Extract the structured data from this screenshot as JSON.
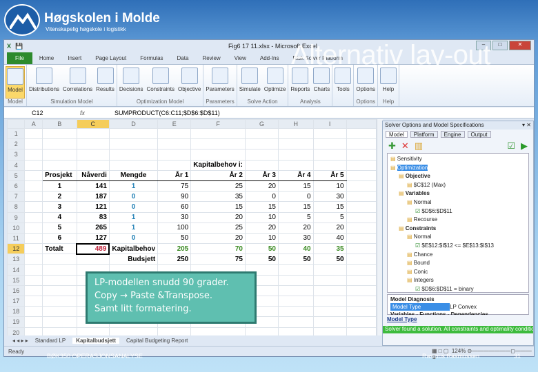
{
  "branding": {
    "org": "Høgskolen i Molde",
    "subtitle": "Vitenskapelig høgskole i logistikk"
  },
  "slide": {
    "title": "Alternativ lay-out",
    "footer_course": "BØK350 OPERASJONSANALYSE",
    "footer_author": "Rasmus Rasmussen",
    "page": "31"
  },
  "window": {
    "title": "Fig6 17 11.xlsx - Microsoft Excel"
  },
  "tabs": [
    "File",
    "Home",
    "Insert",
    "Page Layout",
    "Formulas",
    "Data",
    "Review",
    "View",
    "Add-Ins",
    "Risk Solver Platform"
  ],
  "ribbon": [
    {
      "group": "Model",
      "buttons": [
        "Model"
      ]
    },
    {
      "group": "Simulation Model",
      "buttons": [
        "Distributions",
        "Correlations",
        "Results"
      ]
    },
    {
      "group": "Optimization Model",
      "buttons": [
        "Decisions",
        "Constraints",
        "Objective"
      ]
    },
    {
      "group": "Parameters",
      "buttons": [
        "Parameters"
      ]
    },
    {
      "group": "Solve Action",
      "buttons": [
        "Simulate",
        "Optimize"
      ]
    },
    {
      "group": "Analysis",
      "buttons": [
        "Reports",
        "Charts"
      ]
    },
    {
      "group": "",
      "buttons": [
        "Tools"
      ]
    },
    {
      "group": "Options",
      "buttons": [
        "Options"
      ]
    },
    {
      "group": "Help",
      "buttons": [
        "Help"
      ]
    }
  ],
  "formula_bar": {
    "cell": "C12",
    "fx": "fx",
    "formula": "SUMPRODUCT(C6:C11;$D$6:$D$11)"
  },
  "sheet": {
    "columns": [
      "",
      "A",
      "B",
      "C",
      "D",
      "E",
      "F",
      "G",
      "H",
      "I",
      ""
    ],
    "rows": [
      [
        "1"
      ],
      [
        "2"
      ],
      [
        "3"
      ],
      [
        "4",
        "",
        "",
        "",
        "",
        "",
        "Kapitalbehov i:"
      ],
      [
        "5",
        "",
        "Prosjekt",
        "Nåverdi",
        "Mengde",
        "År 1",
        "År 2",
        "År 3",
        "År 4",
        "År 5"
      ],
      [
        "6",
        "",
        "1",
        "141",
        "1",
        "75",
        "25",
        "20",
        "15",
        "10"
      ],
      [
        "7",
        "",
        "2",
        "187",
        "0",
        "90",
        "35",
        "0",
        "0",
        "30"
      ],
      [
        "8",
        "",
        "3",
        "121",
        "0",
        "60",
        "15",
        "15",
        "15",
        "15"
      ],
      [
        "9",
        "",
        "4",
        "83",
        "1",
        "30",
        "20",
        "10",
        "5",
        "5"
      ],
      [
        "10",
        "",
        "5",
        "265",
        "1",
        "100",
        "25",
        "20",
        "20",
        "20"
      ],
      [
        "11",
        "",
        "6",
        "127",
        "0",
        "50",
        "20",
        "10",
        "30",
        "40"
      ],
      [
        "12",
        "",
        "Totalt",
        "489",
        "Kapitalbehov",
        "205",
        "70",
        "50",
        "40",
        "35"
      ],
      [
        "13",
        "",
        "",
        "",
        "Budsjett",
        "250",
        "75",
        "50",
        "50",
        "50"
      ],
      [
        "14"
      ],
      [
        "15"
      ],
      [
        "16"
      ],
      [
        "17"
      ],
      [
        "18"
      ],
      [
        "19"
      ],
      [
        "20"
      ]
    ],
    "tabs": [
      "Standard LP",
      "Kapitalbudsjett",
      "Capital Budgeting Report"
    ],
    "status": "Ready"
  },
  "solver": {
    "title": "Solver Options and Model Specifications",
    "tabs": [
      "Model",
      "Platform",
      "Engine",
      "Output"
    ],
    "tree": [
      {
        "label": "Sensitivity",
        "lvl": 0
      },
      {
        "label": "Optimization",
        "lvl": 0,
        "sel": true
      },
      {
        "label": "Objective",
        "lvl": 1,
        "b": true
      },
      {
        "label": "$C$12 (Max)",
        "lvl": 2
      },
      {
        "label": "Variables",
        "lvl": 1,
        "b": true
      },
      {
        "label": "Normal",
        "lvl": 2
      },
      {
        "label": "$D$6:$D$11",
        "lvl": 3
      },
      {
        "label": "Recourse",
        "lvl": 2
      },
      {
        "label": "Constraints",
        "lvl": 1,
        "b": true
      },
      {
        "label": "Normal",
        "lvl": 2
      },
      {
        "label": "$E$12:$I$12 <= $E$13:$I$13",
        "lvl": 3
      },
      {
        "label": "Chance",
        "lvl": 2
      },
      {
        "label": "Bound",
        "lvl": 2
      },
      {
        "label": "Conic",
        "lvl": 2
      },
      {
        "label": "Integers",
        "lvl": 2
      },
      {
        "label": "$D$6:$D$11 = binary",
        "lvl": 3
      }
    ],
    "diag_title": "Model Diagnosis",
    "model_type_label": "Model Type",
    "model_type_value": "LP Convex",
    "diag_more": "Variables - Functions - Dependencies",
    "link": "Model Type",
    "status": "Solver found a solution. All constraints and optimality conditions are satisfied.",
    "zoom": "124%"
  },
  "callout": [
    "LP-modellen snudd 90 grader.",
    "Copy → Paste &Transpose.",
    "Samt litt formatering."
  ]
}
